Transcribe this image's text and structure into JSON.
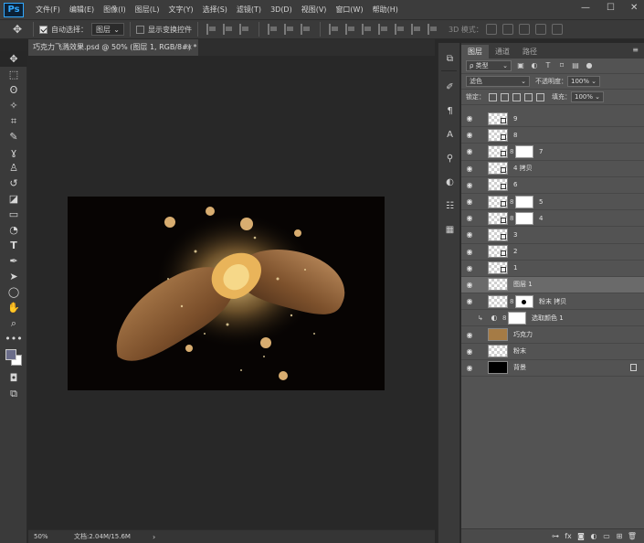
{
  "app": {
    "logo_text": "Ps"
  },
  "menu": [
    "文件(F)",
    "编辑(E)",
    "图像(I)",
    "图层(L)",
    "文字(Y)",
    "选择(S)",
    "滤镜(T)",
    "3D(D)",
    "视图(V)",
    "窗口(W)",
    "帮助(H)"
  ],
  "window_controls": {
    "minimize": "—",
    "maximize": "☐",
    "close": "✕"
  },
  "options_bar": {
    "tool_icon": "move-tool-icon",
    "auto_select_label": "自动选择：",
    "auto_select_checked": true,
    "auto_select_value": "图层",
    "show_transform_label": "显示变换控件",
    "show_transform_checked": false,
    "mode_3d_label": "3D 模式："
  },
  "document": {
    "tab_title": "巧克力飞溅效果.psd @ 50% (图层 1, RGB/8#) *",
    "close_label": "×",
    "zoom": "50%",
    "doc_info": "文档:2.04M/15.6M",
    "status_arrow": "›"
  },
  "panel": {
    "tabs": [
      "图层",
      "通道",
      "路径"
    ],
    "active_tab": 0,
    "menu_icon": "≡",
    "filter_kind": "ρ 类型",
    "blend_mode": "滤色",
    "opacity_label": "不透明度：",
    "opacity_value": "100%",
    "lock_label": "锁定：",
    "fill_label": "填充：",
    "fill_value": "100%"
  },
  "layers": [
    {
      "name": "9",
      "thumb": "checker-so",
      "mask": false,
      "visible": true,
      "selected": false,
      "clipped": false
    },
    {
      "name": "8",
      "thumb": "checker-so",
      "mask": false,
      "visible": true,
      "selected": false,
      "clipped": false
    },
    {
      "name": "7",
      "thumb": "checker-so",
      "mask": true,
      "visible": true,
      "selected": false,
      "clipped": false
    },
    {
      "name": "4 拷贝",
      "thumb": "checker-so",
      "mask": false,
      "visible": true,
      "selected": false,
      "clipped": false
    },
    {
      "name": "6",
      "thumb": "checker-so",
      "mask": false,
      "visible": true,
      "selected": false,
      "clipped": false
    },
    {
      "name": "5",
      "thumb": "checker-so",
      "mask": true,
      "visible": true,
      "selected": false,
      "clipped": false
    },
    {
      "name": "4",
      "thumb": "checker-so",
      "mask": true,
      "visible": true,
      "selected": false,
      "clipped": false
    },
    {
      "name": "3",
      "thumb": "checker-so",
      "mask": false,
      "visible": true,
      "selected": false,
      "clipped": false
    },
    {
      "name": "2",
      "thumb": "checker-so",
      "mask": false,
      "visible": true,
      "selected": false,
      "clipped": false
    },
    {
      "name": "1",
      "thumb": "checker-so",
      "mask": false,
      "visible": true,
      "selected": false,
      "clipped": false
    },
    {
      "name": "图层 1",
      "thumb": "checker",
      "mask": false,
      "visible": true,
      "selected": true,
      "clipped": false
    },
    {
      "name": "粉末 拷贝",
      "thumb": "checker",
      "mask": "dark",
      "visible": true,
      "selected": false,
      "clipped": false
    },
    {
      "name": "选取颜色 1",
      "thumb": "adjustment",
      "mask": true,
      "visible": false,
      "selected": false,
      "clipped": true
    },
    {
      "name": "巧克力",
      "thumb": "photo",
      "mask": false,
      "visible": true,
      "selected": false,
      "clipped": false
    },
    {
      "name": "粉末",
      "thumb": "checker",
      "mask": false,
      "visible": true,
      "selected": false,
      "clipped": false
    },
    {
      "name": "背景",
      "thumb": "black",
      "mask": false,
      "visible": true,
      "selected": false,
      "clipped": false,
      "locked": true
    }
  ],
  "panel_bottom_icons": [
    "link-icon",
    "fx-icon",
    "add-mask-icon",
    "adjustment-icon",
    "group-icon",
    "new-layer-icon",
    "trash-icon"
  ],
  "colors": {
    "foreground": "#6b6d8a",
    "background": "#ffffff",
    "accent": "#31a8ff"
  }
}
